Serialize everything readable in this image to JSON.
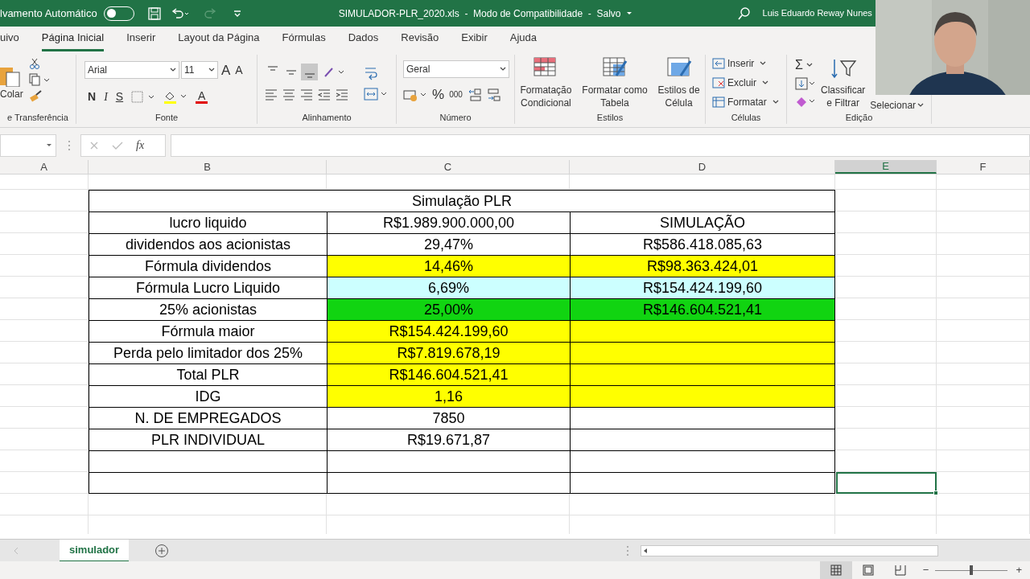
{
  "title_bar": {
    "autosave_label": "lvamento Automático",
    "autosave_on": false,
    "document": "SIMULADOR-PLR_2020.xls  -  Modo de Compatibilidade  -  Salvo",
    "user": "Luis Eduardo Reway Nunes"
  },
  "ribbon_tabs": [
    {
      "label": "uivo",
      "selected": false
    },
    {
      "label": "Página Inicial",
      "selected": true
    },
    {
      "label": "Inserir",
      "selected": false
    },
    {
      "label": "Layout da Página",
      "selected": false
    },
    {
      "label": "Fórmulas",
      "selected": false
    },
    {
      "label": "Dados",
      "selected": false
    },
    {
      "label": "Revisão",
      "selected": false
    },
    {
      "label": "Exibir",
      "selected": false
    },
    {
      "label": "Ajuda",
      "selected": false
    }
  ],
  "ribbon": {
    "clipboard": {
      "paste": "Colar",
      "group": "e Transferência"
    },
    "font": {
      "name": "Arial",
      "size": "11",
      "grow": "A",
      "shrink": "A",
      "bold": "N",
      "italic": "I",
      "underline": "S",
      "color_glyph": "A",
      "group": "Fonte"
    },
    "alignment": {
      "vertical": [
        {
          "selected": false
        },
        {
          "selected": false
        },
        {
          "selected": true
        }
      ],
      "group": "Alinhamento"
    },
    "number": {
      "format": "Geral",
      "percent": "%",
      "thousands": "000",
      "group": "Número"
    },
    "styles": {
      "buttons": [
        {
          "lines": [
            "Formatação",
            "Condicional"
          ]
        },
        {
          "lines": [
            "Formatar como",
            "Tabela"
          ]
        },
        {
          "lines": [
            "Estilos de",
            "Célula"
          ]
        }
      ],
      "group": "Estilos"
    },
    "cells": {
      "buttons": [
        "Inserir",
        "Excluir",
        "Formatar"
      ],
      "group": "Células"
    },
    "editing": {
      "sum": "Σ",
      "sort": [
        "Classificar",
        "e Filtrar"
      ],
      "select": "Selecionar",
      "group": "Edição"
    }
  },
  "formula_bar": {
    "fx": "fx"
  },
  "columns": [
    {
      "label": "A",
      "selected": false
    },
    {
      "label": "B",
      "selected": false
    },
    {
      "label": "C",
      "selected": false
    },
    {
      "label": "D",
      "selected": false
    },
    {
      "label": "E",
      "selected": true
    },
    {
      "label": "F",
      "selected": false
    }
  ],
  "rows": [
    {
      "kind": "title",
      "cells": [
        {
          "text": "Simulação PLR"
        }
      ]
    },
    {
      "kind": "data",
      "cells": [
        {
          "text": "lucro liquido"
        },
        {
          "text": "R$1.989.900.000,00"
        },
        {
          "text": "SIMULAÇÃO"
        }
      ]
    },
    {
      "kind": "data",
      "cells": [
        {
          "text": "dividendos aos acionistas"
        },
        {
          "text": "29,47%"
        },
        {
          "text": "R$586.418.085,63"
        }
      ]
    },
    {
      "kind": "data",
      "cells": [
        {
          "text": "Fórmula dividendos"
        },
        {
          "text": "14,46%",
          "color": "#ffff00"
        },
        {
          "text": "R$98.363.424,01",
          "color": "#ffff00"
        }
      ]
    },
    {
      "kind": "data",
      "cells": [
        {
          "text": "Fórmula Lucro Liquido"
        },
        {
          "text": "6,69%",
          "color": "#ccffff"
        },
        {
          "text": "R$154.424.199,60",
          "color": "#ccffff"
        }
      ]
    },
    {
      "kind": "data",
      "cells": [
        {
          "text": "25% acionistas"
        },
        {
          "text": "25,00%",
          "color": "#11d411"
        },
        {
          "text": "R$146.604.521,41",
          "color": "#11d411"
        }
      ]
    },
    {
      "kind": "data",
      "cells": [
        {
          "text": "Fórmula maior"
        },
        {
          "text": "R$154.424.199,60",
          "color": "#ffff00"
        },
        {
          "color": "#ffff00"
        }
      ]
    },
    {
      "kind": "data",
      "cells": [
        {
          "text": "Perda pelo limitador dos 25%"
        },
        {
          "text": "R$7.819.678,19",
          "color": "#ffff00"
        },
        {
          "color": "#ffff00"
        }
      ]
    },
    {
      "kind": "data",
      "cells": [
        {
          "text": "Total PLR"
        },
        {
          "text": "R$146.604.521,41",
          "color": "#ffff00"
        },
        {
          "color": "#ffff00"
        }
      ]
    },
    {
      "kind": "data",
      "cells": [
        {
          "text": "IDG"
        },
        {
          "text": "1,16",
          "color": "#ffff00"
        },
        {
          "color": "#ffff00"
        }
      ]
    },
    {
      "kind": "data",
      "cells": [
        {
          "text": "N. DE EMPREGADOS"
        },
        {
          "text": "7850"
        },
        {}
      ]
    },
    {
      "kind": "data",
      "cells": [
        {
          "text": "PLR INDIVIDUAL"
        },
        {
          "text": "R$19.671,87"
        },
        {}
      ]
    },
    {
      "kind": "data",
      "cells": [
        {},
        {},
        {}
      ]
    },
    {
      "kind": "data",
      "cells": [
        {},
        {},
        {}
      ],
      "selected": true
    }
  ],
  "sheet_tabs": [
    {
      "label": "simulador",
      "selected": true
    }
  ],
  "status_bar": {
    "views": [
      {
        "selected": true
      },
      {
        "selected": false
      },
      {
        "selected": false
      }
    ],
    "zoom_out": "−",
    "zoom_in": "+",
    "zoom": {
      "level": 0.5
    }
  }
}
